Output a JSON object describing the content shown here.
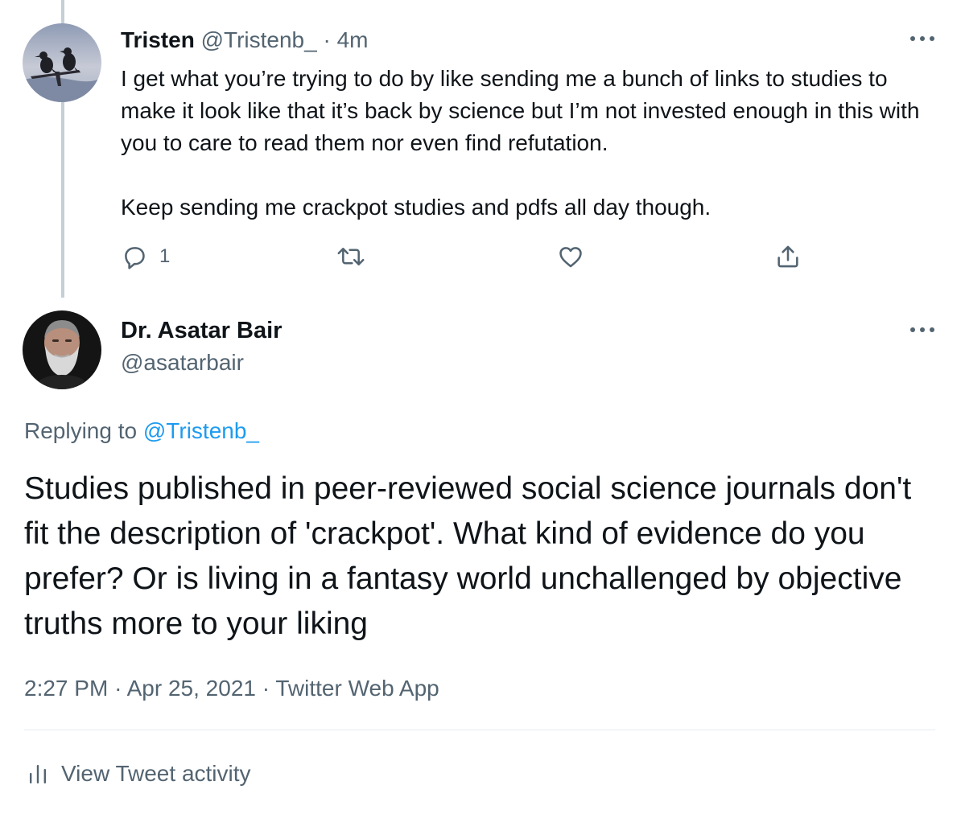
{
  "reply_tweet": {
    "display_name": "Tristen",
    "handle": "@Tristenb_",
    "separator": "·",
    "time": "4m",
    "text_paragraph_1": "I get what you’re trying to do by like sending me a bunch of links to studies to make it look like that it’s back by science but I’m not invested enough in this with you to care to read them nor even find refutation.",
    "text_paragraph_2": "Keep sending me crackpot studies and pdfs all day though.",
    "reply_count": "1",
    "avatar": "crows-on-branch-avatar",
    "icons": [
      "reply-icon",
      "retweet-icon",
      "like-icon",
      "share-icon",
      "more-icon"
    ]
  },
  "main_tweet": {
    "display_name": "Dr. Asatar Bair",
    "handle": "@asatarbair",
    "replying_prefix": "Replying to",
    "replying_to": "@Tristenb_",
    "text": "Studies published in peer-reviewed social science journals don't fit the description of 'crackpot'. What kind of evidence do you prefer? Or is living in a fantasy world unchallenged by objective truths more to your liking",
    "time": "2:27 PM",
    "separator": "·",
    "date": "Apr 25, 2021",
    "source": "Twitter Web App",
    "activity_label": "View Tweet activity",
    "avatar": "bearded-man-avatar"
  },
  "colors": {
    "text": "#0f1419",
    "muted": "#536471",
    "link": "#1d9bf0",
    "thread_line": "#c4cfd6",
    "divider": "#e6ecf0"
  }
}
